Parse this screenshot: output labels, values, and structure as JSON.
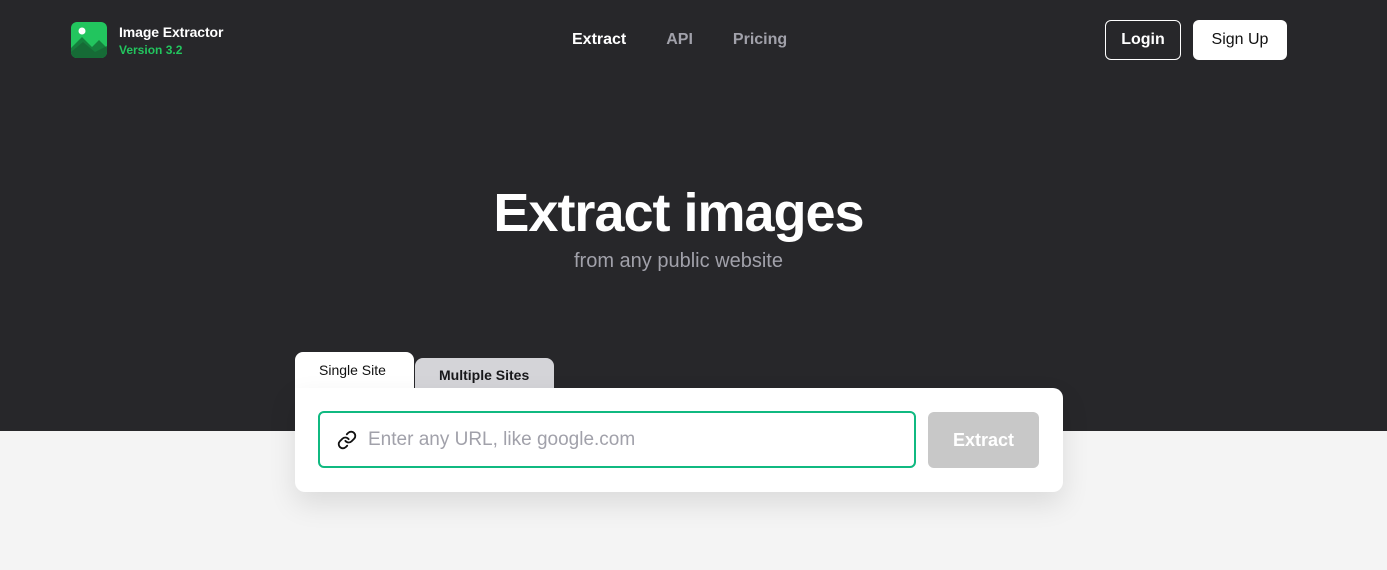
{
  "brand": {
    "name": "Image Extractor",
    "version": "Version 3.2",
    "logo_icon": "image-icon"
  },
  "nav": {
    "items": [
      "Extract",
      "API",
      "Pricing"
    ],
    "active": "Extract"
  },
  "auth": {
    "login_label": "Login",
    "signup_label": "Sign Up"
  },
  "hero": {
    "title": "Extract images",
    "subtitle": "from any public website"
  },
  "tabs": {
    "single": "Single Site",
    "multiple": "Multiple Sites",
    "selected": "Single Site"
  },
  "form": {
    "url_placeholder": "Enter any URL, like google.com",
    "url_value": "",
    "url_icon": "link-icon",
    "submit_label": "Extract"
  },
  "colors": {
    "hero_background": "#27272a",
    "page_background": "#f4f4f4",
    "accent": "#10b981",
    "version_text": "#22c55e",
    "disabled_button": "#c8c8c8"
  }
}
